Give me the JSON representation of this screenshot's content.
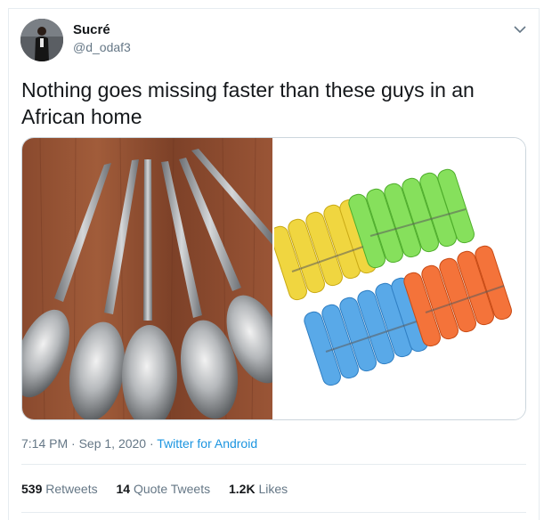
{
  "tweet": {
    "display_name": "Sucré",
    "handle": "@d_odaf3",
    "text": "Nothing goes missing faster than these guys in an African home",
    "time": "7:14 PM · Sep 1, 2020 · ",
    "source": "Twitter for Android",
    "icons": {
      "menu": "chevron-down-icon"
    }
  },
  "stats": {
    "retweets_count": "539",
    "retweets_label": " Retweets",
    "quotes_count": "14",
    "quotes_label": " Quote Tweets",
    "likes_count": "1.2K",
    "likes_label": " Likes"
  },
  "colors": {
    "link": "#1b95e0",
    "secondary": "#657786",
    "border": "#e6ecf0"
  }
}
